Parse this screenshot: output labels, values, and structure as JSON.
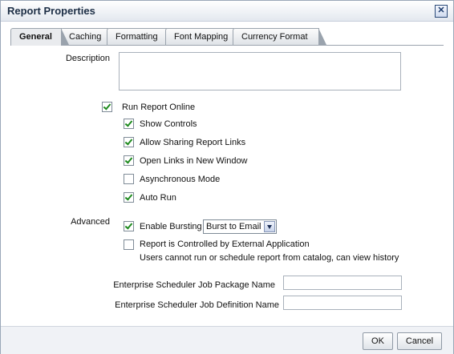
{
  "dialog": {
    "title": "Report Properties"
  },
  "tabs": [
    {
      "label": "General",
      "active": true
    },
    {
      "label": "Caching"
    },
    {
      "label": "Formatting"
    },
    {
      "label": "Font Mapping"
    },
    {
      "label": "Currency Format"
    }
  ],
  "general": {
    "description_label": "Description",
    "description_value": "",
    "run_online": {
      "label": "Run Report Online",
      "checked": true
    },
    "show_controls": {
      "label": "Show Controls",
      "checked": true
    },
    "allow_sharing": {
      "label": "Allow Sharing Report Links",
      "checked": true
    },
    "open_links": {
      "label": "Open Links in New Window",
      "checked": true
    },
    "async_mode": {
      "label": "Asynchronous Mode",
      "checked": false
    },
    "auto_run": {
      "label": "Auto Run",
      "checked": true
    },
    "advanced_label": "Advanced",
    "enable_bursting": {
      "label": "Enable Bursting",
      "checked": true
    },
    "bursting_select_value": "Burst to Email",
    "external_app": {
      "label": "Report is Controlled by External Application",
      "checked": false,
      "note": "Users cannot run or schedule report from catalog, can view history"
    },
    "job_package_label": "Enterprise Scheduler Job Package Name",
    "job_package_value": "",
    "job_definition_label": "Enterprise Scheduler Job Definition Name",
    "job_definition_value": ""
  },
  "buttons": {
    "ok": "OK",
    "cancel": "Cancel"
  }
}
